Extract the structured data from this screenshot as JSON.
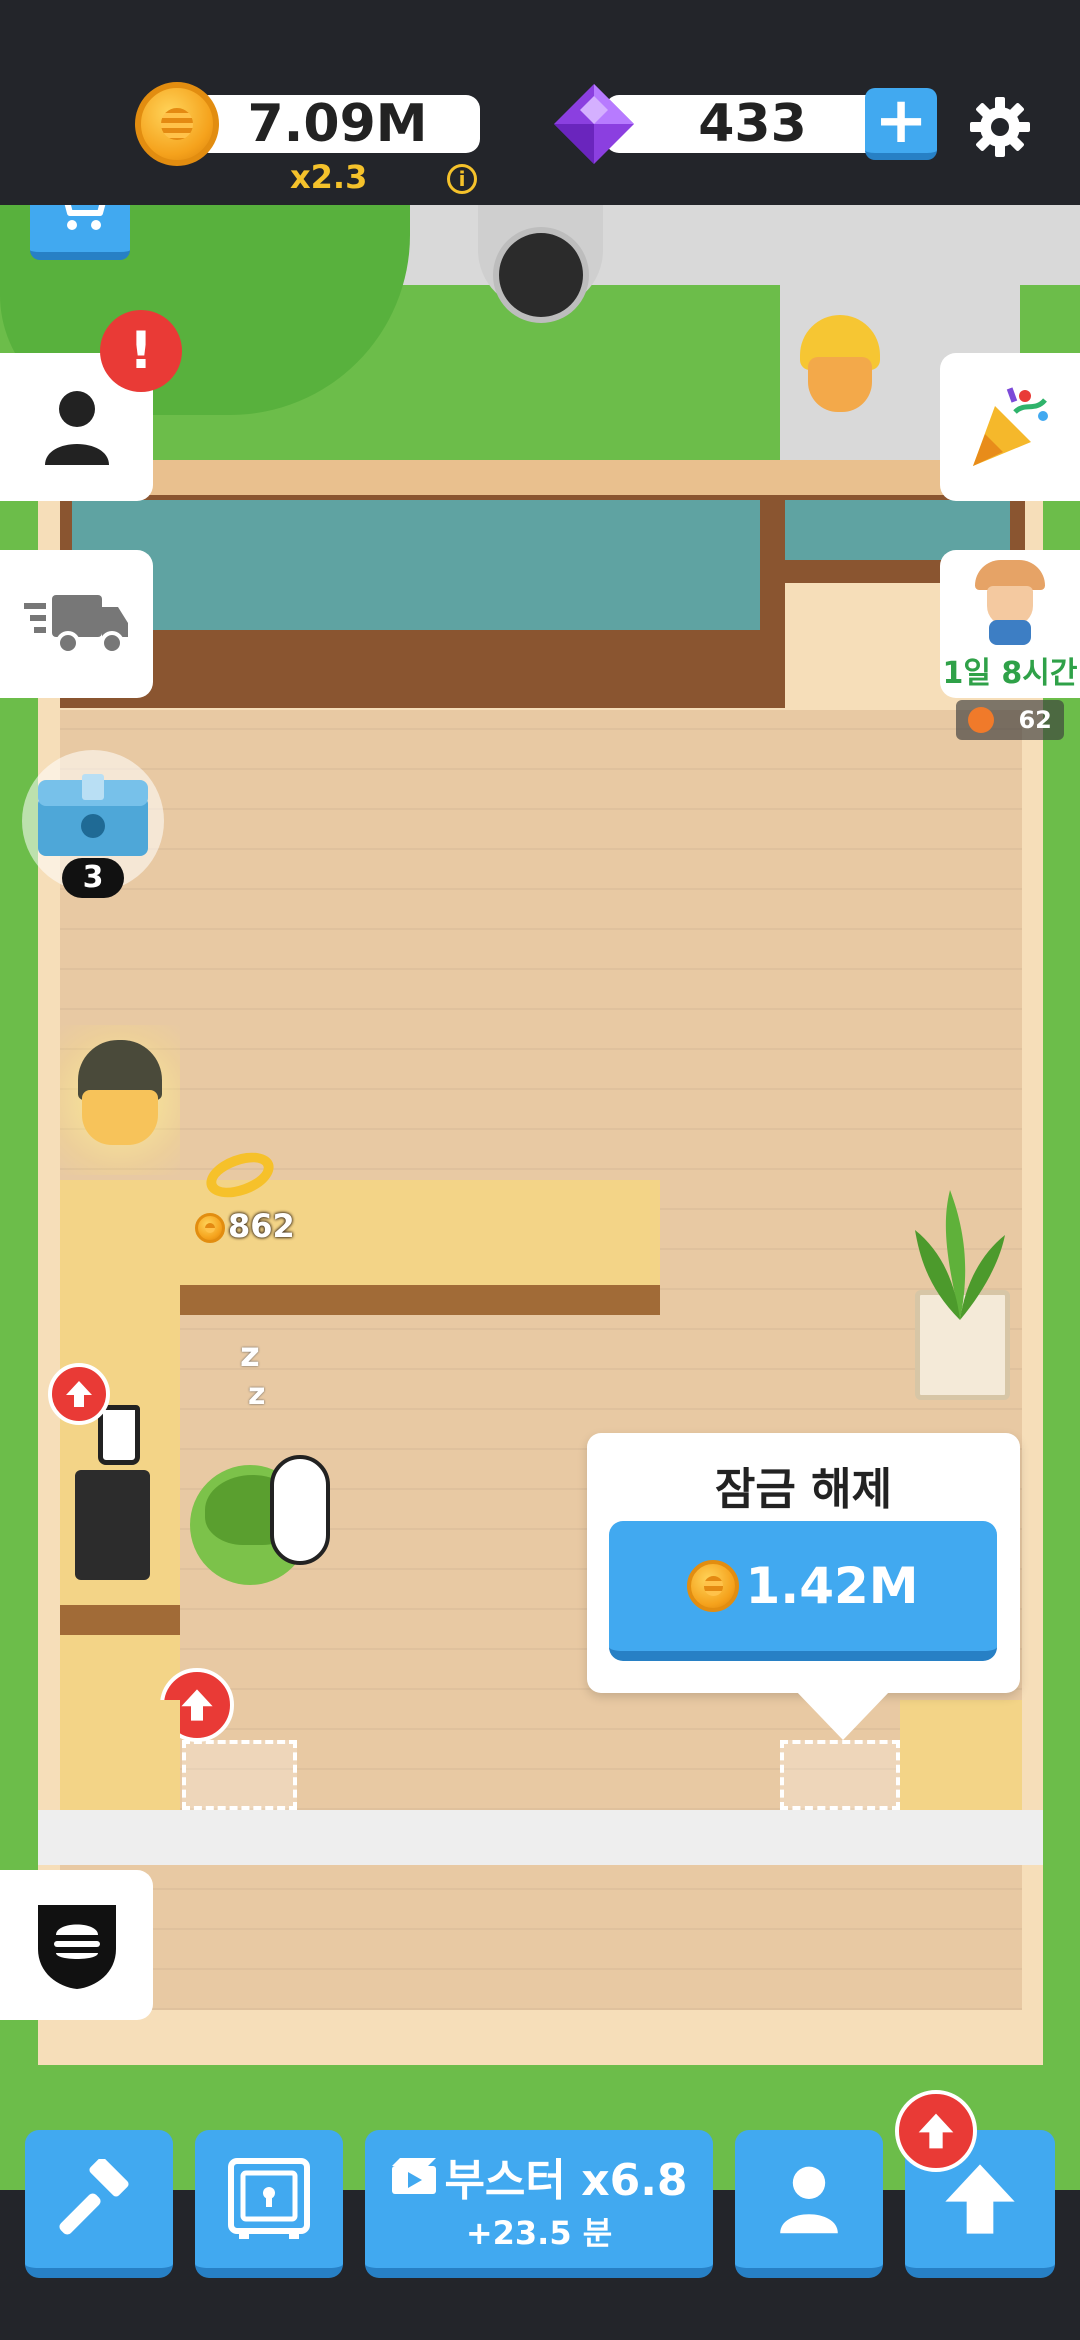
{
  "hud": {
    "coins_value": "7.09M",
    "multiplier": "x2.3",
    "info_icon": "i",
    "gems_value": "433",
    "add_gems_symbol": "+"
  },
  "side_right": {
    "event_timer": "1일 8시간",
    "event_tokens": "62"
  },
  "chest": {
    "count": "3"
  },
  "counter": {
    "coin_pickup_amount": "862"
  },
  "unlock_popup": {
    "title": "잠금 해제",
    "cost": "1.42M"
  },
  "bottom_bar": {
    "booster_label": "부스터 x6.8",
    "booster_time": "+23.5 분"
  },
  "colors": {
    "accent_blue": "#41a9f0",
    "alert_red": "#e93a36",
    "grass": "#6cbd4a",
    "floor": "#e8c9a3",
    "counter": "#f3d487"
  },
  "icons": [
    "cart-icon",
    "coin-icon",
    "gem-icon",
    "plus-icon",
    "gear-icon",
    "person-icon",
    "alert-icon",
    "truck-icon",
    "party-popper-icon",
    "chest-icon",
    "burger-shield-icon",
    "hammer-icon",
    "safe-icon",
    "video-icon",
    "arrow-up-icon",
    "sleep-z-icon"
  ]
}
